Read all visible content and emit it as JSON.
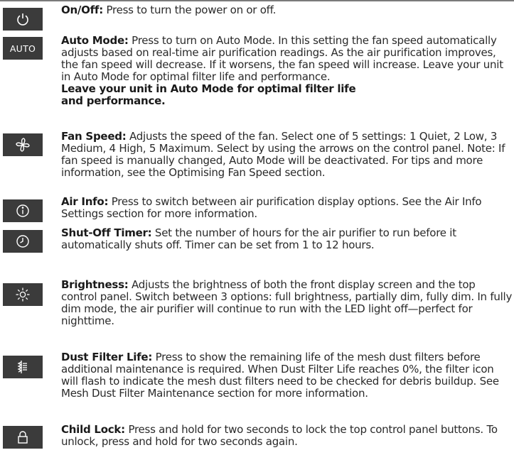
{
  "items": [
    {
      "icon": "power-icon",
      "title": "On/Off:",
      "body": " Press to turn the power on or off."
    },
    {
      "icon": "auto-badge",
      "badge_text": "AUTO",
      "title": "Auto Mode:",
      "body": " Press to turn on Auto Mode. In this setting the fan speed automatically adjusts based on real-time air purification readings. As the air purification improves, the fan speed will decrease. If it worsens, the fan speed will increase. Leave your unit in Auto Mode for optimal filter life and performance.",
      "note": "Leave your unit in Auto Mode for optimal filter life and performance."
    },
    {
      "icon": "fan-icon",
      "title": "Fan Speed:",
      "body": " Adjusts the speed of the fan. Select one of 5 settings: 1 Quiet, 2 Low, 3 Medium, 4 High, 5 Maximum. Select by using the arrows on the control panel. Note: If fan speed is manually changed, Auto Mode will be deactivated. For tips and more information, see the Optimising Fan Speed section."
    },
    {
      "icon": "info-icon",
      "title": "Air Info:",
      "body": " Press to switch between air purification display options. See the Air Info Settings section for more information."
    },
    {
      "icon": "clock-icon",
      "title": "Shut-Off Timer:",
      "body": " Set the number of hours for the air purifier to run before it automatically shuts off. Timer can be set from 1 to 12 hours."
    },
    {
      "icon": "brightness-icon",
      "title": "Brightness:",
      "body": " Adjusts the brightness of both the front display screen and the top control panel. Switch between 3 options: full brightness, partially dim, fully dim. In fully dim mode, the air purifier will continue to run with the LED light off—perfect for nighttime."
    },
    {
      "icon": "filter-icon",
      "title": "Dust Filter Life:",
      "body": "  Press to show the remaining life of the mesh dust filters before additional maintenance is required. When Dust Filter Life reaches 0%, the filter icon will flash to indicate the mesh dust filters need to be checked for debris buildup. See Mesh Dust Filter Maintenance section for more information."
    },
    {
      "icon": "lock-icon",
      "title": "Child Lock:",
      "body": " Press and hold for two seconds to lock the top control panel buttons. To unlock, press and hold for two seconds again."
    }
  ]
}
